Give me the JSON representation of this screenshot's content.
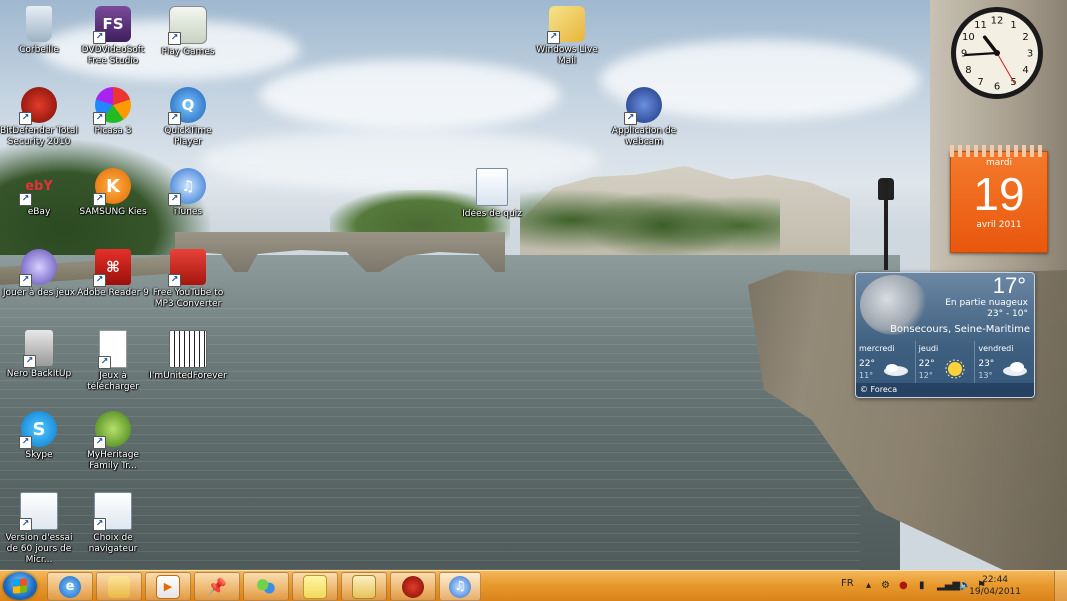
{
  "desktop": {
    "icons": [
      {
        "label": "Corbeille"
      },
      {
        "label": "DVDVideoSoft Free Studio",
        "glyph": "FS"
      },
      {
        "label": "Play Games"
      },
      {
        "label": "Windows Live Mail"
      },
      {
        "label": "BitDefender Total Security 2010"
      },
      {
        "label": "Picasa 3"
      },
      {
        "label": "QuickTime Player"
      },
      {
        "label": "Application de webcam"
      },
      {
        "label": "Idées de quiz"
      },
      {
        "label": "eBay",
        "glyph": "ebY"
      },
      {
        "label": "SAMSUNG Kies",
        "glyph": "K"
      },
      {
        "label": "iTunes"
      },
      {
        "label": "Jouer à des jeux"
      },
      {
        "label": "Adobe Reader 9"
      },
      {
        "label": "Free YouTube to MP3 Converter"
      },
      {
        "label": "Nero BackItUp"
      },
      {
        "label": "Jeux à télécharger"
      },
      {
        "label": "I'mUnitedForever"
      },
      {
        "label": "Skype"
      },
      {
        "label": "MyHeritage Family Tr..."
      },
      {
        "label": "Version d'essai de 60 jours de Micr..."
      },
      {
        "label": "Choix de navigateur"
      }
    ]
  },
  "gadgets": {
    "clock": {
      "hour": 10,
      "minute": 44,
      "second": 25
    },
    "calendar": {
      "weekday": "mardi",
      "day": "19",
      "month_year": "avril 2011"
    },
    "weather": {
      "current_temp": "17°",
      "condition": "En partie nuageux",
      "range": "23° - 10°",
      "location": "Bonsecours, Seine-Maritime",
      "forecast": [
        {
          "day": "mercredi",
          "high": "22°",
          "low": "11°",
          "icon": "cloud-icon"
        },
        {
          "day": "jeudi",
          "high": "22°",
          "low": "12°",
          "icon": "sun-icon"
        },
        {
          "day": "vendredi",
          "high": "23°",
          "low": "13°",
          "icon": "cloud-icon"
        }
      ],
      "provider": "© Foreca"
    }
  },
  "taskbar": {
    "language": "FR",
    "time": "22:44",
    "date": "19/04/2011",
    "pinned": [
      "internet-explorer-icon",
      "file-explorer-icon",
      "media-player-icon",
      "pushpin-icon",
      "messenger-icon",
      "sticky-notes-icon",
      "mail-icon",
      "bitdefender-icon",
      "itunes-icon"
    ]
  },
  "colors": {
    "taskbar": "#e89a2e",
    "calendar": "#f06a1e",
    "weather": "#3e5f7f"
  }
}
